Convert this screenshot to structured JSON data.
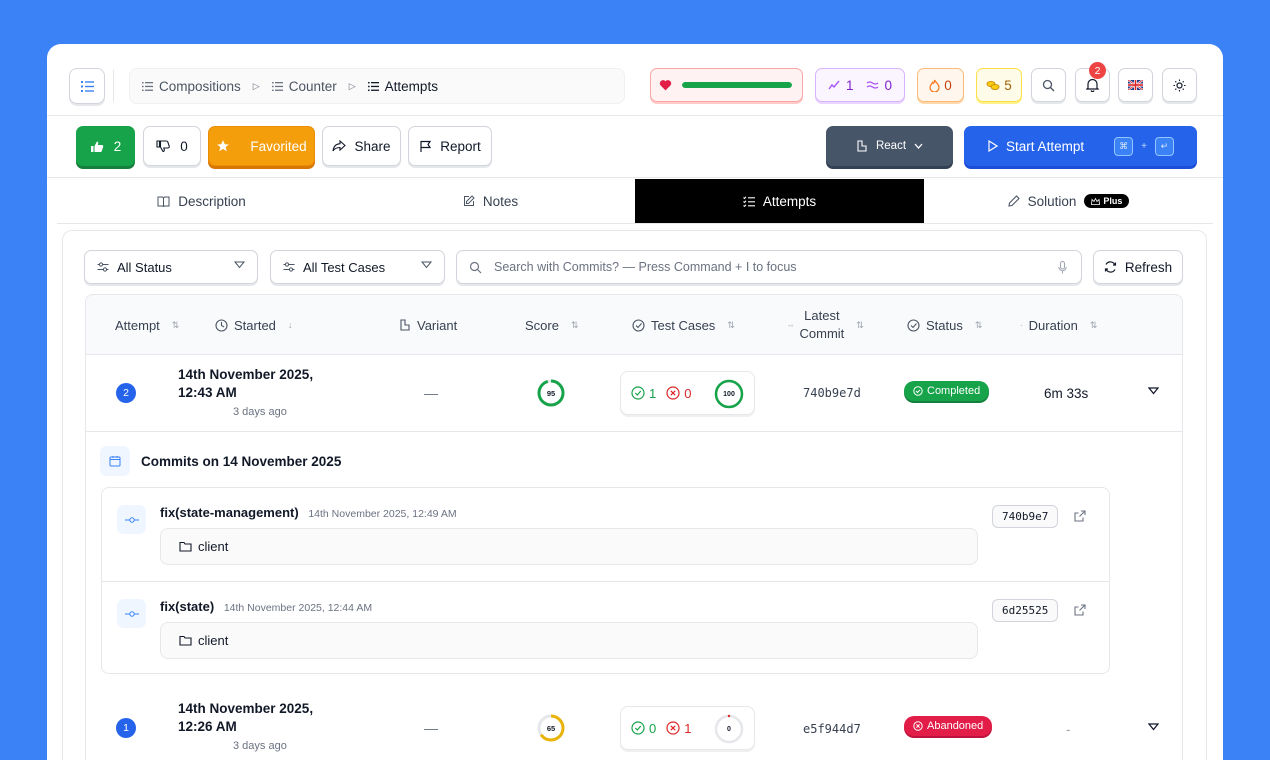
{
  "breadcrumb": [
    {
      "label": "Compositions"
    },
    {
      "label": "Counter"
    },
    {
      "label": "Attempts"
    }
  ],
  "stats": {
    "health_fraction": 1.0,
    "streak_count": "1",
    "waves_count": "0",
    "fire_count": "0",
    "coins_count": "5",
    "notifications_count": "2"
  },
  "actions": {
    "likes": "2",
    "dislikes": "0",
    "favorited_label": "Favorited",
    "share_label": "Share",
    "report_label": "Report",
    "framework_label": "React",
    "start_label": "Start Attempt",
    "shortcut_key1": "⌘",
    "shortcut_plus": "+",
    "shortcut_key2": "↵"
  },
  "tabs": [
    {
      "label": "Description"
    },
    {
      "label": "Notes"
    },
    {
      "label": "Attempts"
    },
    {
      "label": "Solution"
    }
  ],
  "solution_tag": "Plus",
  "filters": {
    "status": "All Status",
    "test_cases": "All Test Cases",
    "search_placeholder": "Search with Commits? — Press Command + I to focus",
    "refresh_label": "Refresh"
  },
  "table": {
    "headers": {
      "attempt": "Attempt",
      "started": "Started",
      "variant": "Variant",
      "score": "Score",
      "test_cases": "Test Cases",
      "latest_commit_1": "Latest",
      "latest_commit_2": "Commit",
      "status": "Status",
      "duration": "Duration"
    },
    "rows": [
      {
        "num": "2",
        "date_line1": "14th November 2025,",
        "date_line2": "12:43 AM",
        "ago": "3 days ago",
        "variant": "—",
        "score": "95",
        "passed": "1",
        "failed": "0",
        "pct": "100",
        "commit": "740b9e7d",
        "status": "Completed",
        "duration": "6m 33s"
      },
      {
        "num": "1",
        "date_line1": "14th November 2025,",
        "date_line2": "12:26 AM",
        "ago": "3 days ago",
        "variant": "—",
        "score": "65",
        "passed": "0",
        "failed": "1",
        "pct": "0",
        "commit": "e5f944d7",
        "status": "Abandoned",
        "duration": "-"
      }
    ]
  },
  "commits": {
    "title": "Commits on 14 November 2025",
    "items": [
      {
        "message": "fix(state-management)",
        "date": "14th November 2025, 12:49 AM",
        "folder": "client",
        "hash": "740b9e7"
      },
      {
        "message": "fix(state)",
        "date": "14th November 2025, 12:44 AM",
        "folder": "client",
        "hash": "6d25525"
      }
    ]
  },
  "colors": {
    "background": "#3b82f6",
    "primary": "#2563eb",
    "success": "#16a34a",
    "danger": "#e11d48",
    "warning": "#f59e0b"
  }
}
